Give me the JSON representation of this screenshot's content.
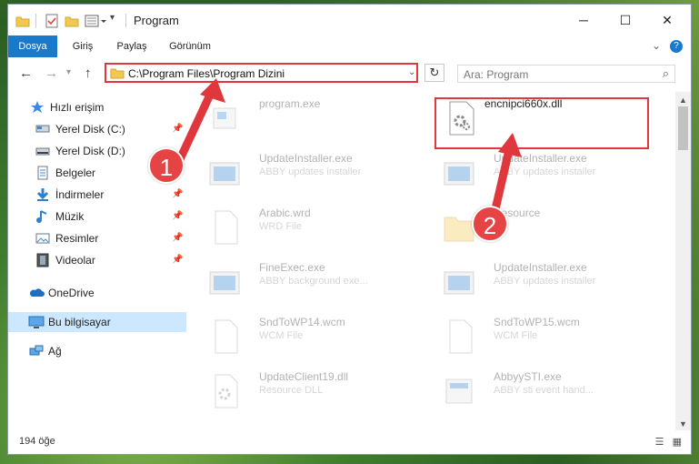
{
  "window": {
    "title": "Program",
    "minimize": "─",
    "maximize": "☐",
    "close": "✕"
  },
  "ribbon": {
    "tabs": [
      {
        "label": "Dosya",
        "active": true
      },
      {
        "label": "Giriş",
        "active": false
      },
      {
        "label": "Paylaş",
        "active": false
      },
      {
        "label": "Görünüm",
        "active": false
      }
    ],
    "expand_icon": "chevron-down-icon",
    "help_icon": "help-icon"
  },
  "address": {
    "path": "C:\\Program Files\\Program Dizini",
    "search_placeholder": "Ara: Program"
  },
  "sidebar": {
    "items": [
      {
        "label": "Hızlı erişim",
        "icon": "star-icon"
      },
      {
        "label": "Yerel Disk (C:)",
        "icon": "drive-icon",
        "pinned": true
      },
      {
        "label": "Yerel Disk (D:)",
        "icon": "drive-icon"
      },
      {
        "label": "Belgeler",
        "icon": "documents-icon"
      },
      {
        "label": "İndirmeler",
        "icon": "download-icon",
        "pinned": true
      },
      {
        "label": "Müzik",
        "icon": "music-icon",
        "pinned": true
      },
      {
        "label": "Resimler",
        "icon": "pictures-icon",
        "pinned": true
      },
      {
        "label": "Videolar",
        "icon": "videos-icon",
        "pinned": true
      },
      {
        "label": "OneDrive",
        "icon": "cloud-icon"
      },
      {
        "label": "Bu bilgisayar",
        "icon": "computer-icon",
        "selected": true
      },
      {
        "label": "Ağ",
        "icon": "network-icon"
      }
    ]
  },
  "files": [
    {
      "name": "program.exe",
      "desc": "",
      "type": "exe"
    },
    {
      "name": "encnipci660x.dll",
      "desc": "",
      "type": "dll"
    },
    {
      "name": "UpdateInstaller.exe",
      "desc": "ABBY updates installer",
      "type": "app"
    },
    {
      "name": "UpdateInstaller.exe",
      "desc": "ABBY updates installer",
      "type": "app"
    },
    {
      "name": "Arabic.wrd",
      "desc": "WRD File",
      "type": "doc"
    },
    {
      "name": "Resource",
      "desc": "",
      "type": "folder"
    },
    {
      "name": "FineExec.exe",
      "desc": "ABBY background exe...",
      "type": "app"
    },
    {
      "name": "UpdateInstaller.exe",
      "desc": "ABBY updates installer",
      "type": "app"
    },
    {
      "name": "SndToWP14.wcm",
      "desc": "WCM File",
      "type": "doc"
    },
    {
      "name": "SndToWP15.wcm",
      "desc": "WCM File",
      "type": "doc"
    },
    {
      "name": "UpdateClient19.dll",
      "desc": "Resource DLL",
      "type": "dll"
    },
    {
      "name": "AbbyySTI.exe",
      "desc": "ABBY sti event hand...",
      "type": "app"
    }
  ],
  "status": {
    "count": "194 öğe"
  },
  "annotations": {
    "step1": "1",
    "step2": "2",
    "accent": "#e0373c"
  }
}
